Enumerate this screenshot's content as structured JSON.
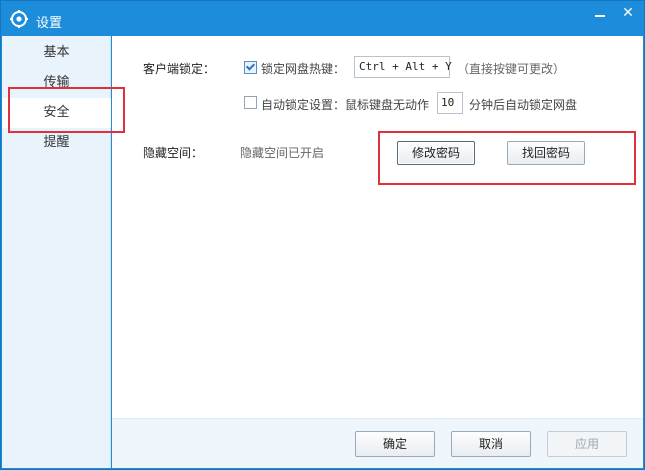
{
  "window": {
    "title": "设置",
    "minimize_label": "—",
    "close_label": "✕"
  },
  "sidebar": {
    "items": [
      {
        "label": "基本",
        "active": false
      },
      {
        "label": "传输",
        "active": false
      },
      {
        "label": "安全",
        "active": true
      },
      {
        "label": "提醒",
        "active": false
      }
    ]
  },
  "client_lock": {
    "label": "客户端锁定：",
    "hotkey_checkbox_label": "锁定网盘热键：",
    "hotkey_checked": true,
    "hotkey_value": "Ctrl + Alt + Y",
    "hotkey_hint": "（直接按键可更改）",
    "auto_lock_checked": false,
    "auto_lock_label": "自动锁定设置：鼠标键盘无动作",
    "auto_lock_minutes": "10",
    "auto_lock_suffix": "分钟后自动锁定网盘"
  },
  "hidden_space": {
    "label": "隐藏空间：",
    "status": "隐藏空间已开启",
    "change_password": "修改密码",
    "recover_password": "找回密码"
  },
  "footer": {
    "ok": "确定",
    "cancel": "取消",
    "apply": "应用"
  },
  "colors": {
    "titlebar": "#1d8ddb",
    "highlight": "#e0303b",
    "sidebar_bg": "#e9f3fb"
  }
}
